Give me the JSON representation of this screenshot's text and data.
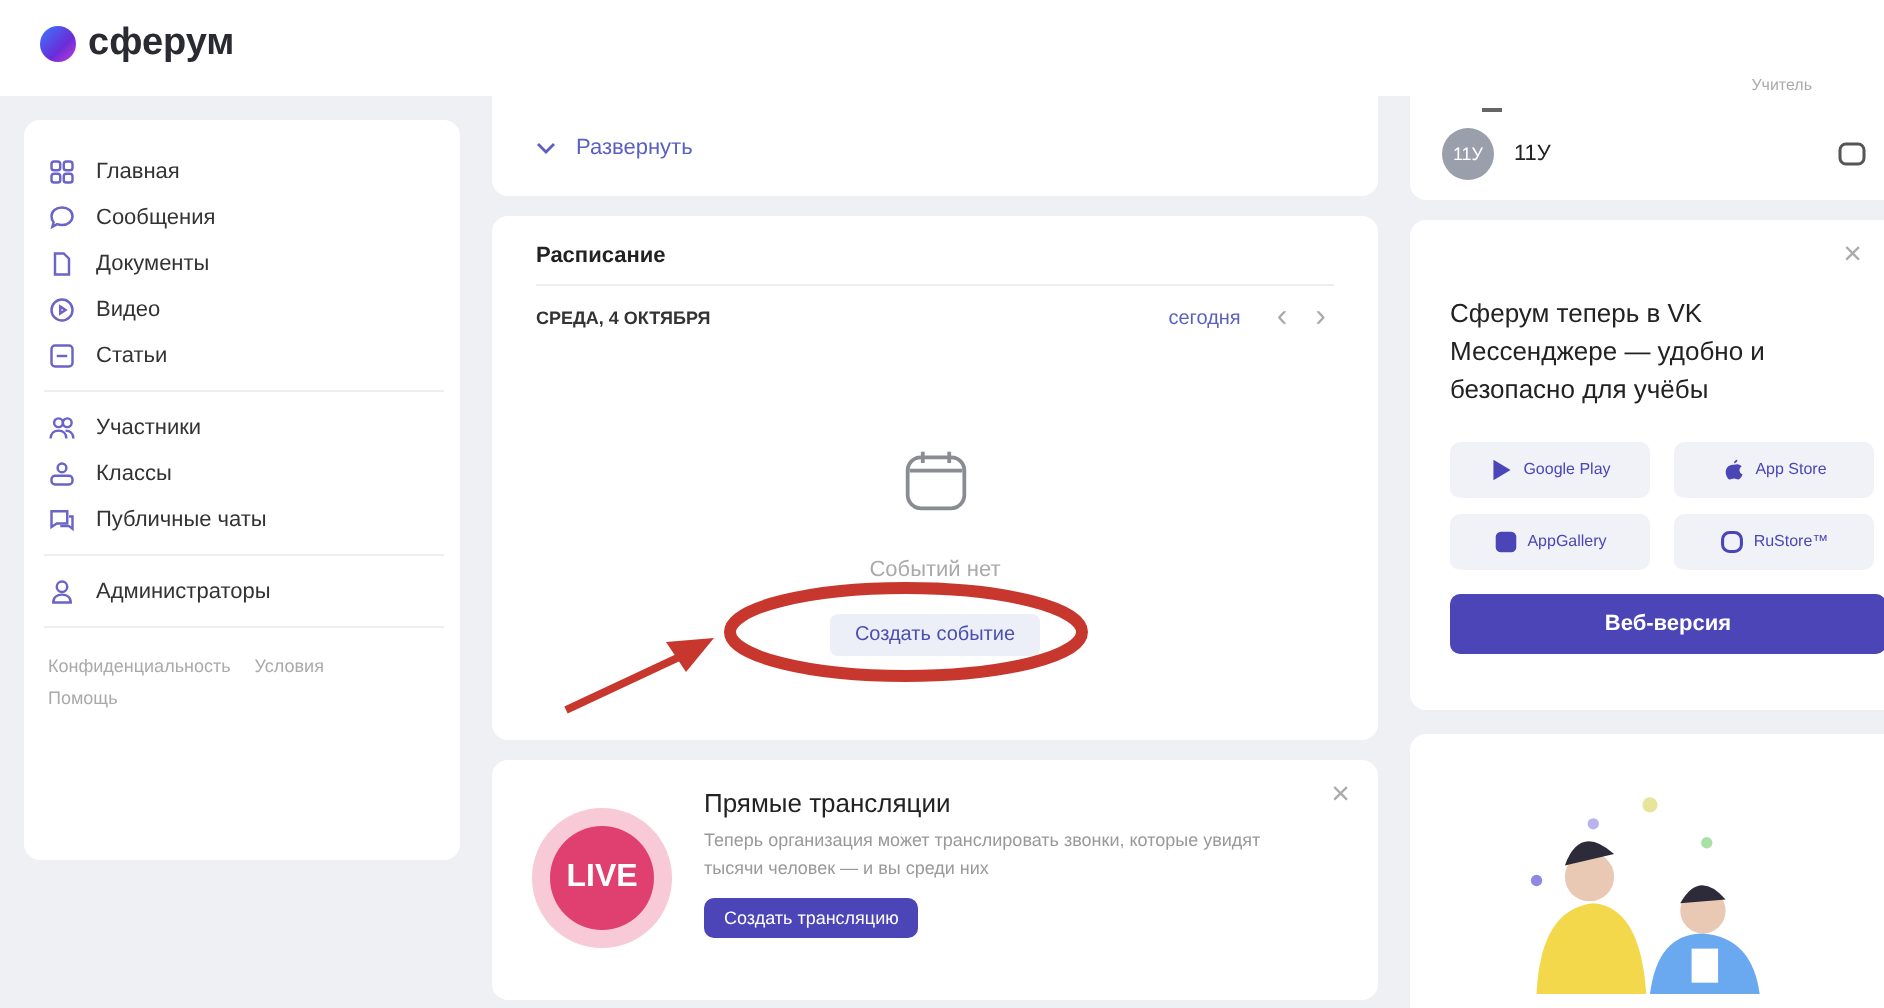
{
  "header": {
    "logo_text": "сферум",
    "role": "Учитель"
  },
  "sidebar": {
    "sections": [
      {
        "items": [
          {
            "label": "Главная",
            "selected": false
          },
          {
            "label": "Сообщения",
            "selected": false
          },
          {
            "label": "Документы",
            "selected": false
          },
          {
            "label": "Видео",
            "selected": false
          },
          {
            "label": "Статьи",
            "selected": false
          }
        ]
      },
      {
        "items": [
          {
            "label": "Участники",
            "selected": false
          },
          {
            "label": "Классы",
            "selected": false
          },
          {
            "label": "Публичные чаты",
            "selected": false
          }
        ]
      },
      {
        "items": [
          {
            "label": "Администраторы",
            "selected": false
          }
        ]
      }
    ],
    "footer_links": [
      "Конфиденциальность",
      "Условия",
      "Помощь"
    ]
  },
  "expand_card": {
    "label": "Развернуть"
  },
  "schedule": {
    "title": "Расписание",
    "date": "СРЕДА, 4 ОКТЯБРЯ",
    "today": "сегодня",
    "prev": "‹",
    "next": "›",
    "empty_text": "Событий нет",
    "create_button": "Создать событие"
  },
  "live": {
    "badge": "LIVE",
    "title": "Прямые трансляции",
    "text": "Теперь организация может транслировать звонки, которые увидят тысячи человек — и вы среди них",
    "button": "Создать трансляцию",
    "close": "×"
  },
  "chat": {
    "avatar": "11У",
    "name": "11У"
  },
  "promo": {
    "close": "×",
    "text": "Сферум теперь в VK Мессенджере — удобно и безопасно для учёбы",
    "stores": [
      "Google Play",
      "App Store",
      "AppGallery",
      "RuStore™"
    ],
    "web_button": "Веб-версия"
  }
}
